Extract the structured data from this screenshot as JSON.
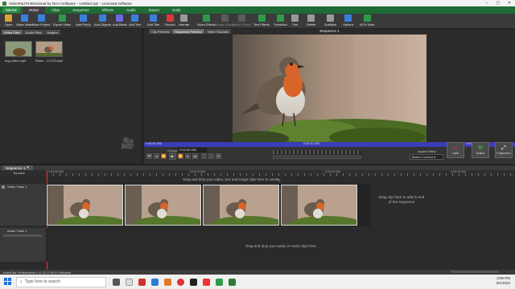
{
  "window": {
    "title": "VideoPad Professional by NCH Software - Untitled.vpj* - Licensed software"
  },
  "menubar": {
    "menu_button": "Menu",
    "tabs": [
      "Home",
      "Clips",
      "Sequence",
      "Effects",
      "Audio",
      "Export",
      "Suite"
    ],
    "active_tab": "Home"
  },
  "toolbar": {
    "items": [
      {
        "label": "Open",
        "color": "#d9a23a",
        "icon": "folder-icon"
      },
      {
        "label": "Video Maker",
        "color": "#3a7fd9",
        "icon": "video-maker-icon"
      },
      {
        "label": "Save Project",
        "color": "#3a7fd9",
        "icon": "save-icon"
      },
      {
        "label": "Export Video",
        "color": "#2e9a4a",
        "icon": "export-icon"
      },
      {
        "label": "Add File(s)",
        "color": "#3a7fd9",
        "icon": "add-file-icon"
      },
      {
        "label": "Add Objects",
        "color": "#3a7fd9",
        "icon": "add-objects-icon"
      },
      {
        "label": "Add Blank",
        "color": "#6a6ad9",
        "icon": "add-blank-icon"
      },
      {
        "label": "Add Text",
        "color": "#3a7fd9",
        "icon": "add-text-icon"
      },
      {
        "label": "Add Title",
        "color": "#3a7fd9",
        "icon": "add-title-icon"
      },
      {
        "label": "Record",
        "color": "#d93a3a",
        "icon": "record-icon"
      },
      {
        "label": "Narrate",
        "color": "#999999",
        "icon": "narrate-icon"
      },
      {
        "label": "Video Effects",
        "color": "#2e9a4a",
        "icon": "video-effects-icon"
      },
      {
        "label": "Image Effects",
        "color": "#5a5a5a",
        "icon": "image-effects-icon",
        "disabled": true
      },
      {
        "label": "Audio Effects",
        "color": "#5a5a5a",
        "icon": "audio-effects-icon",
        "disabled": true
      },
      {
        "label": "Text Effects",
        "color": "#2e9a4a",
        "icon": "text-effects-icon"
      },
      {
        "label": "Transition",
        "color": "#2e9a4a",
        "icon": "transition-icon"
      },
      {
        "label": "Trim",
        "color": "#999999",
        "icon": "trim-icon"
      },
      {
        "label": "Delete",
        "color": "#999999",
        "icon": "delete-icon"
      },
      {
        "label": "Subtitles",
        "color": "#999999",
        "icon": "subtitles-icon"
      },
      {
        "label": "Options",
        "color": "#3a7fd9",
        "icon": "options-icon"
      },
      {
        "label": "NCH Suite",
        "color": "#2e9a4a",
        "icon": "suite-icon"
      }
    ]
  },
  "bin": {
    "tabs": [
      "Video Files",
      "Audio Files",
      "Images"
    ],
    "active_tab": "Video Files",
    "files": [
      {
        "name": "dog video.mp4"
      },
      {
        "name": "Robin - 21723.mp4"
      }
    ]
  },
  "preview": {
    "tabs": [
      "Clip Preview",
      "Sequence Preview",
      "Video Tutorials"
    ],
    "active_tab": "Sequence Preview",
    "sequence_title": "Sequence 1",
    "ruler_labels": [
      "0:00:00.000",
      "0:00:10.000",
      "0:00:20.000"
    ],
    "cursor_label": "Cursor:",
    "cursor_value": "0:00:00.000",
    "aspect_ratio_label": "Aspect Ratio:",
    "aspect_ratio_value": "Match Content",
    "split_label": "Split",
    "unlink_label": "Unlink",
    "fullscreen_label": "Fullscreen"
  },
  "timeline": {
    "sequence_tab": "Sequence 1",
    "ruler_label": "Timeline",
    "ruler_ticks": [
      "0:00:00.000",
      "0:00:10.000",
      "0:00:20.000",
      "0:00:30.000",
      "0:00:40.000"
    ],
    "video_track": "Video Track 1",
    "audio_track": "Audio Track 1",
    "drop_video_hint": "Drag and drop your video, text and image clips here to overlay",
    "add_end_hint": "Drag clip here to add to end of the sequence",
    "drop_audio_hint": "Drag and drop your audio or music clips here"
  },
  "status": {
    "text": "VideoPad Professional v 11.22 © NCH Software"
  },
  "taskbar": {
    "search_placeholder": "Type here to search",
    "time": "3:06 PM",
    "date": "3/1/2022"
  }
}
